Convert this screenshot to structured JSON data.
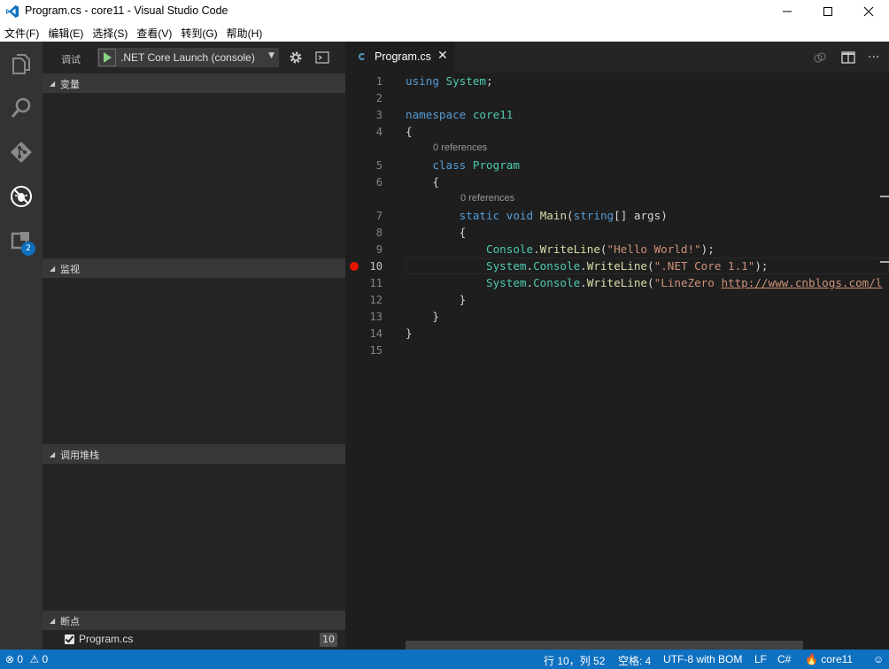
{
  "window": {
    "title": "Program.cs - core11 - Visual Studio Code"
  },
  "menu": [
    "文件(F)",
    "编辑(E)",
    "选择(S)",
    "查看(V)",
    "转到(G)",
    "帮助(H)"
  ],
  "activity": {
    "extensions_badge": "2"
  },
  "debug": {
    "label": "调试",
    "config": ".NET Core Launch (console)"
  },
  "sections": {
    "variables": "变量",
    "watch": "监视",
    "callstack": "调用堆栈",
    "breakpoints": "断点"
  },
  "breakpoint": {
    "file": "Program.cs",
    "line": "10"
  },
  "editor": {
    "tab": "Program.cs",
    "line_numbers": [
      "1",
      "2",
      "3",
      "4",
      "5",
      "6",
      "7",
      "8",
      "9",
      "10",
      "11",
      "12",
      "13",
      "14",
      "15"
    ],
    "codelens": [
      "0 references",
      "0 references"
    ],
    "code": {
      "l1_kw": "using",
      "l1_ns": "System",
      "l1_end": ";",
      "l3_kw": "namespace",
      "l3_name": "core11",
      "l4": "{",
      "l5_kw": "class",
      "l5_name": "Program",
      "l6": "{",
      "l7_kw1": "static",
      "l7_kw2": "void",
      "l7_fn": "Main",
      "l7_p1": "(",
      "l7_type": "string",
      "l7_rest": "[] args)",
      "l8": "{",
      "l9_cls": "Console",
      "l9_dot": ".",
      "l9_fn": "WriteLine",
      "l9_p1": "(",
      "l9_str": "\"Hello World!\"",
      "l9_end": ");",
      "l10_ns": "System",
      "l10_cls": "Console",
      "l10_fn": "WriteLine",
      "l10_str": "\".NET Core 1.1\"",
      "l10_end": ");",
      "l11_ns": "System",
      "l11_cls": "Console",
      "l11_fn": "WriteLine",
      "l11_str": "\"LineZero ",
      "l11_url": "http://www.cnblogs.com/l",
      "l12": "}",
      "l13": "}",
      "l14": "}"
    }
  },
  "status": {
    "errors": "0",
    "warnings": "0",
    "position": "行 10，列 52",
    "indent": "空格: 4",
    "encoding": "UTF-8 with BOM",
    "eol": "LF",
    "language": "C#",
    "project": "core11"
  }
}
